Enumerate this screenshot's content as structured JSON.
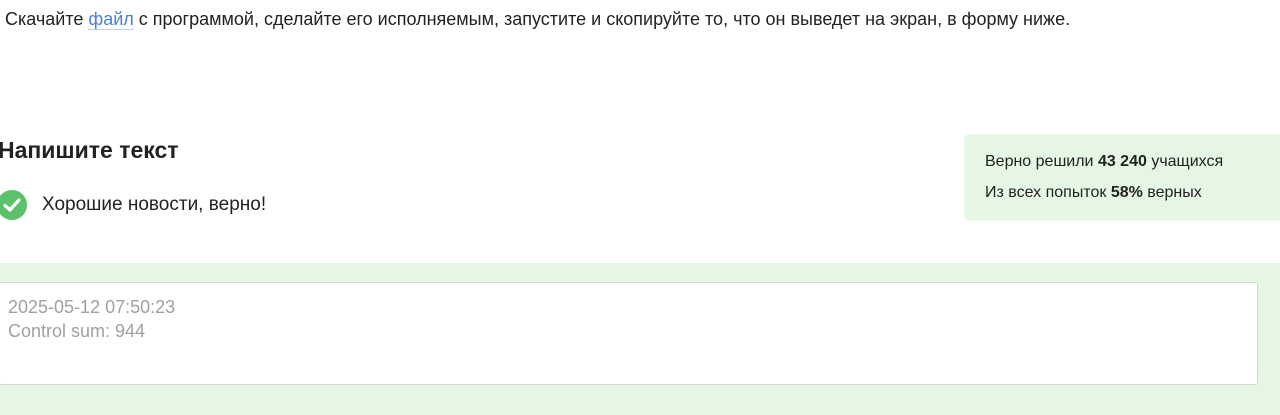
{
  "instruction": {
    "before_link": "Скачайте ",
    "link_text": "файл",
    "after_link": " с программой, сделайте его исполняемым, запустите и скопируйте то, что он выведет на экран, в форму ниже."
  },
  "task": {
    "title": "Напишите текст",
    "feedback": "Хорошие новости, верно!"
  },
  "stats": {
    "line1_prefix": "Верно решили ",
    "solved_count": "43 240",
    "line1_suffix": " учащихся",
    "line2_prefix": "Из всех попыток ",
    "correct_percent": "58%",
    "line2_suffix": " верных"
  },
  "answer": {
    "lines": [
      "2025-05-12 07:50:23",
      "Control sum: 944"
    ]
  },
  "colors": {
    "link": "#4a7fd4",
    "success_green": "#5cc16a",
    "panel_background": "#e6f6e4",
    "answer_text": "#a0a0a0"
  },
  "icons": {
    "feedback": "check-circle-icon"
  }
}
